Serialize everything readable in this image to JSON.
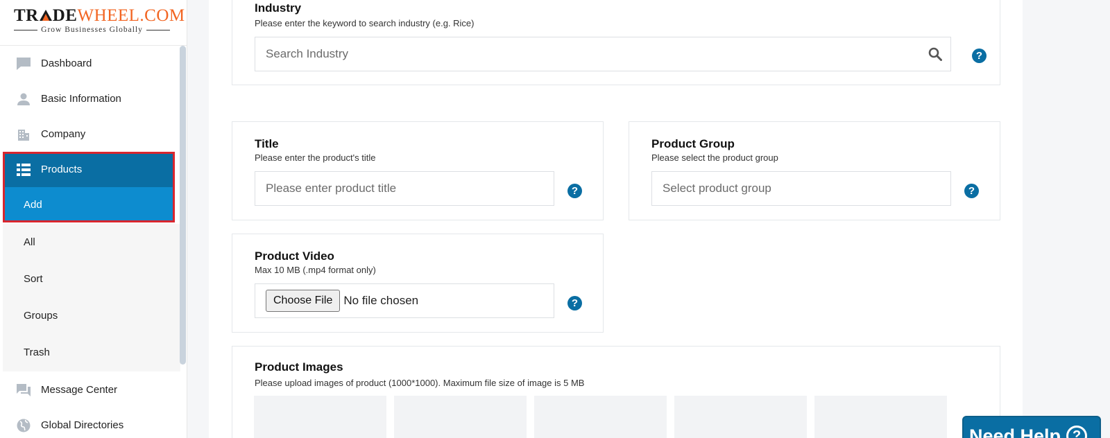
{
  "logo": {
    "part1": "TR",
    "part2": "DE",
    "part3": "WHEEL.COM",
    "tagline": "Grow Businesses Globally"
  },
  "sidebar": {
    "items": [
      {
        "label": "Dashboard",
        "icon": "chat-bubble-icon"
      },
      {
        "label": "Basic Information",
        "icon": "person-icon"
      },
      {
        "label": "Company",
        "icon": "building-icon"
      }
    ],
    "products": {
      "label": "Products",
      "icon": "list-icon"
    },
    "add": {
      "label": "Add"
    },
    "sub_items": [
      {
        "label": "All"
      },
      {
        "label": "Sort"
      },
      {
        "label": "Groups"
      },
      {
        "label": "Trash"
      }
    ],
    "bottom_items": [
      {
        "label": "Message Center",
        "icon": "messages-icon"
      },
      {
        "label": "Global Directories",
        "icon": "globe-icon"
      }
    ]
  },
  "form": {
    "industry": {
      "title": "Industry",
      "desc": "Please enter the keyword to search industry (e.g. Rice)",
      "placeholder": "Search Industry"
    },
    "title_field": {
      "title": "Title",
      "desc": "Please enter the product's title",
      "placeholder": "Please enter product title"
    },
    "product_group": {
      "title": "Product Group",
      "desc": "Please select the product group",
      "placeholder": "Select product group"
    },
    "video": {
      "title": "Product Video",
      "desc": "Max 10 MB (.mp4 format only)",
      "button": "Choose File",
      "status": "No file chosen"
    },
    "images": {
      "title": "Product Images",
      "desc": "Please upload images of product (1000*1000). Maximum file size of image is 5 MB"
    },
    "help_glyph": "?"
  },
  "need_help": {
    "label": "Need Help",
    "glyph": "?"
  },
  "colors": {
    "primary": "#0a6ea3",
    "active_sub": "#0d8ccf",
    "highlight": "#d9262e",
    "logo_orange": "#f26522"
  }
}
